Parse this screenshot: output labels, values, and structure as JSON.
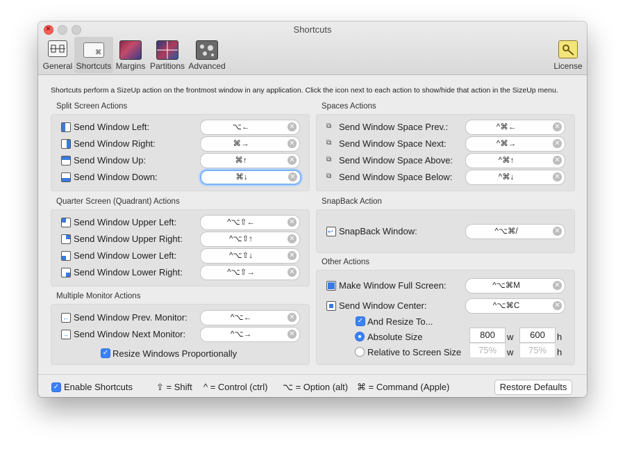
{
  "window": {
    "title": "Shortcuts"
  },
  "toolbar": {
    "items": [
      {
        "label": "General",
        "icon": "general-prefs-icon"
      },
      {
        "label": "Shortcuts",
        "icon": "keyboard-icon",
        "selected": true
      },
      {
        "label": "Margins",
        "icon": "margins-icon"
      },
      {
        "label": "Partitions",
        "icon": "partitions-icon"
      },
      {
        "label": "Advanced",
        "icon": "advanced-icon"
      },
      {
        "label": "License",
        "icon": "license-key-icon"
      }
    ]
  },
  "intro": "Shortcuts perform a SizeUp action on the frontmost window in any application. Click the icon next to each action to show/hide that action in the SizeUp menu.",
  "split": {
    "title": "Split Screen Actions",
    "rows": [
      {
        "label": "Send Window Left:",
        "shortcut": "⌥←"
      },
      {
        "label": "Send Window Right:",
        "shortcut": "⌘→"
      },
      {
        "label": "Send Window Up:",
        "shortcut": "⌘↑"
      },
      {
        "label": "Send Window Down:",
        "shortcut": "⌘↓"
      }
    ]
  },
  "quarter": {
    "title": "Quarter Screen (Quadrant) Actions",
    "rows": [
      {
        "label": "Send Window Upper Left:",
        "shortcut": "^⌥⇧←"
      },
      {
        "label": "Send Window Upper Right:",
        "shortcut": "^⌥⇧↑"
      },
      {
        "label": "Send Window Lower Left:",
        "shortcut": "^⌥⇧↓"
      },
      {
        "label": "Send Window Lower Right:",
        "shortcut": "^⌥⇧→"
      }
    ]
  },
  "monitor": {
    "title": "Multiple Monitor Actions",
    "rows": [
      {
        "label": "Send Window Prev. Monitor:",
        "shortcut": "^⌥←"
      },
      {
        "label": "Send Window Next Monitor:",
        "shortcut": "^⌥→"
      }
    ],
    "resize_label": "Resize Windows Proportionally"
  },
  "spaces": {
    "title": "Spaces Actions",
    "rows": [
      {
        "label": "Send Window Space Prev.:",
        "shortcut": "^⌘←"
      },
      {
        "label": "Send Window Space Next:",
        "shortcut": "^⌘→"
      },
      {
        "label": "Send Window Space Above:",
        "shortcut": "^⌘↑"
      },
      {
        "label": "Send Window Space Below:",
        "shortcut": "^⌘↓"
      }
    ]
  },
  "snapback": {
    "title": "SnapBack Action",
    "rows": [
      {
        "label": "SnapBack Window:",
        "shortcut": "^⌥⌘/"
      }
    ]
  },
  "other": {
    "title": "Other Actions",
    "rows": [
      {
        "label": "Make Window Full Screen:",
        "shortcut": "^⌥⌘M"
      },
      {
        "label": "Send Window Center:",
        "shortcut": "^⌥⌘C"
      }
    ],
    "and_resize": "And Resize To...",
    "absolute": {
      "label": "Absolute Size",
      "w": "800",
      "h": "600"
    },
    "relative": {
      "label": "Relative to Screen Size",
      "w": "75%",
      "h": "75%"
    },
    "w_unit": "w",
    "h_unit": "h"
  },
  "footer": {
    "enable_label": "Enable Shortcuts",
    "legend_shift": "⇧ = Shift",
    "legend_control": "^ = Control (ctrl)",
    "legend_option": "⌥ = Option (alt)",
    "legend_command": "⌘ = Command (Apple)",
    "restore_button": "Restore Defaults"
  },
  "colors": {
    "accent": "#3b82f6",
    "focus_ring": "#7ab2f4",
    "panel": "#e2e2e2"
  }
}
